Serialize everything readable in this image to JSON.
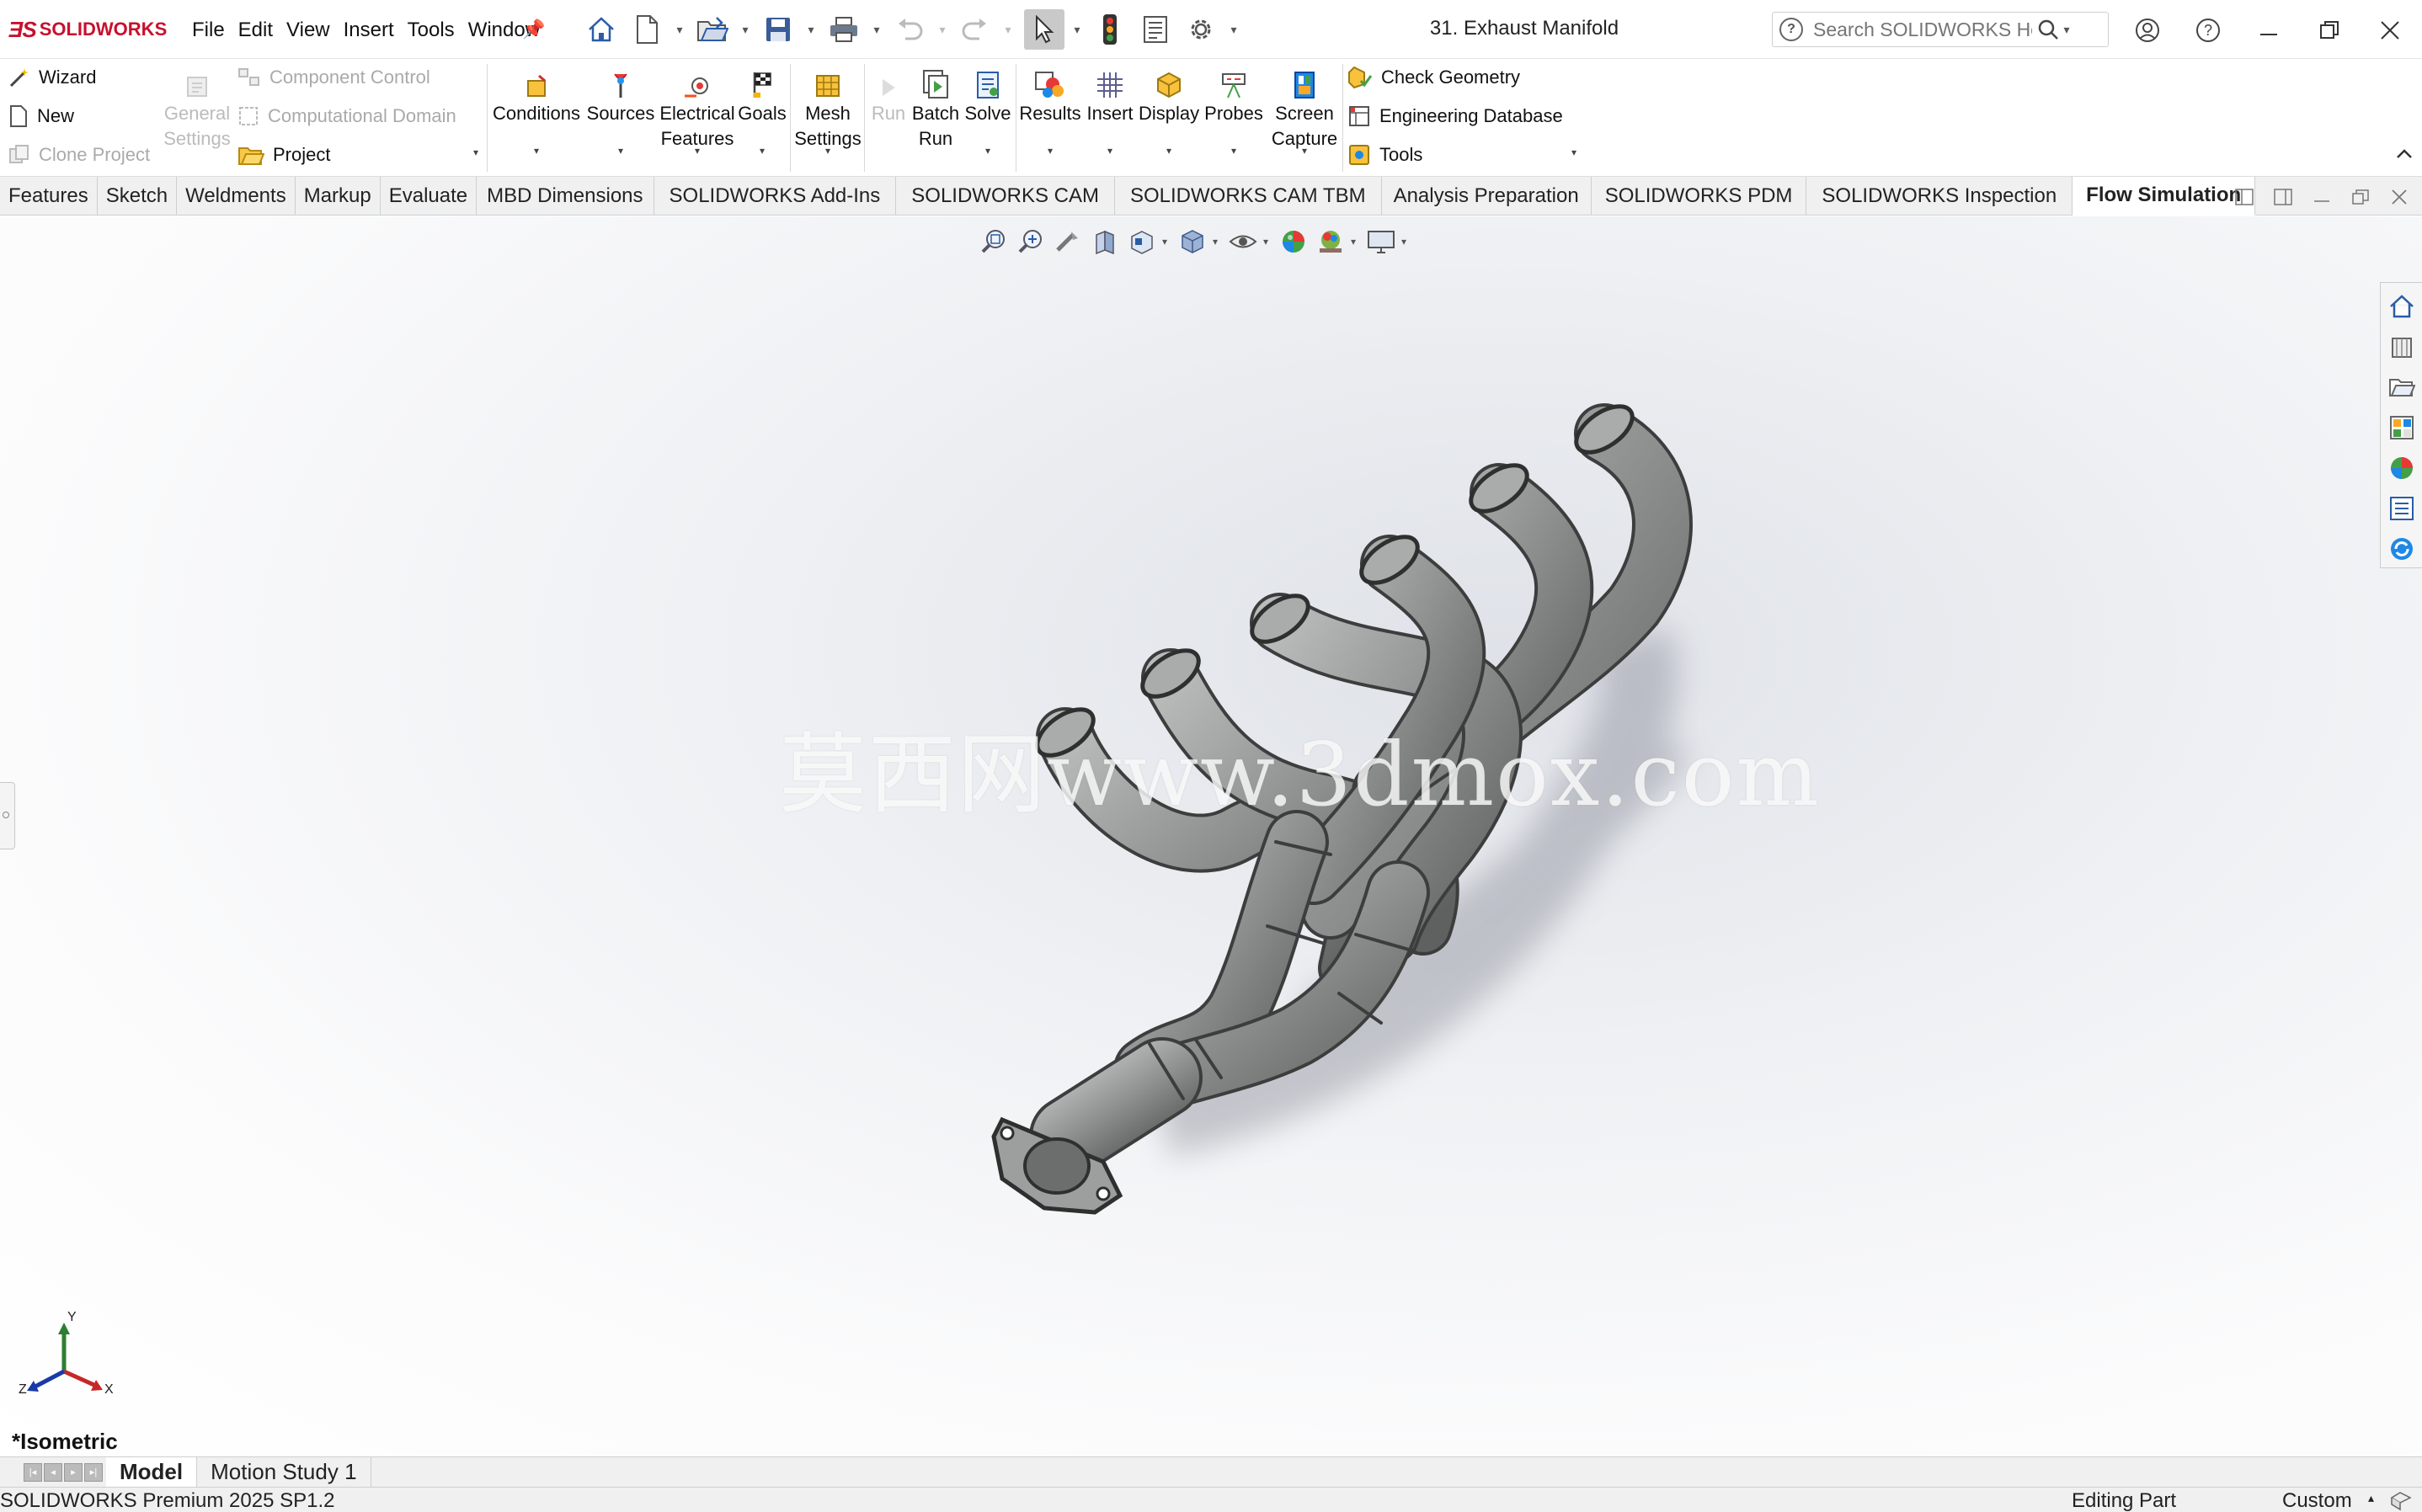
{
  "app": {
    "brand": "SOLIDWORKS",
    "document_title": "31. Exhaust Manifold"
  },
  "menu": [
    "File",
    "Edit",
    "View",
    "Insert",
    "Tools",
    "Window"
  ],
  "help_search": {
    "placeholder": "Search SOLIDWORKS Help"
  },
  "command_manager": {
    "project_group": {
      "wizard": "Wizard",
      "new": "New",
      "clone_project": "Clone Project",
      "general_settings": "General Settings",
      "component_control": "Component Control",
      "computational_domain": "Computational Domain",
      "project": "Project"
    },
    "conditions": "Conditions",
    "sources": "Sources",
    "electrical_features": "Electrical Features",
    "goals": "Goals",
    "mesh_settings": "Mesh Settings",
    "run": "Run",
    "batch_run": "Batch Run",
    "solve": "Solve",
    "results": "Results",
    "insert": "Insert",
    "display": "Display",
    "probes": "Probes",
    "screen_capture": "Screen Capture",
    "check_geometry": "Check Geometry",
    "engineering_database": "Engineering Database",
    "tools": "Tools"
  },
  "tabs": [
    "Features",
    "Sketch",
    "Weldments",
    "Markup",
    "Evaluate",
    "MBD Dimensions",
    "SOLIDWORKS Add-Ins",
    "SOLIDWORKS CAM",
    "SOLIDWORKS CAM TBM",
    "Analysis Preparation",
    "SOLIDWORKS PDM",
    "SOLIDWORKS Inspection",
    "Flow Simulation"
  ],
  "active_tab": "Flow Simulation",
  "viewport": {
    "watermark": "莫西网www.3dmox.com",
    "view_orientation": "*Isometric",
    "triad": {
      "x": "X",
      "y": "Y",
      "z": "Z"
    }
  },
  "bottom_tabs": [
    "Model",
    "Motion Study 1"
  ],
  "status": {
    "version": "SOLIDWORKS Premium 2025 SP1.2",
    "mode": "Editing Part",
    "units": "Custom"
  },
  "colors": {
    "brand_red": "#c8102e",
    "model_gray": "#8a8d8c",
    "selection_bg": "#c9c9c9"
  }
}
